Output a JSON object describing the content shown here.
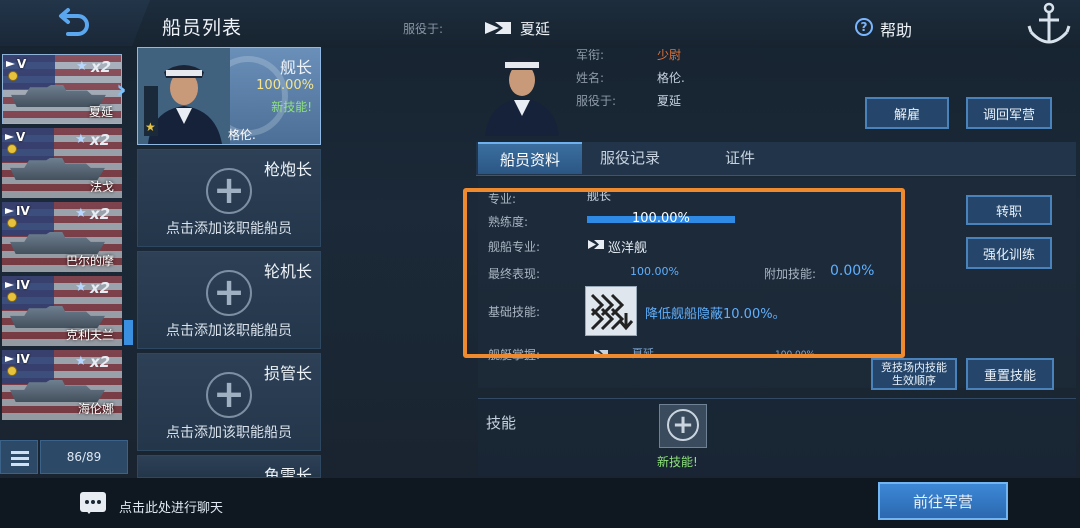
{
  "header": {
    "title": "船员列表",
    "serve_label": "服役于:",
    "serve_ship": "夏延",
    "help": "帮助"
  },
  "ship_list": [
    {
      "tier": "V",
      "count": "x2",
      "name": "夏延",
      "active": true
    },
    {
      "tier": "V",
      "count": "x2",
      "name": "法戈"
    },
    {
      "tier": "IV",
      "count": "x2",
      "name": "巴尔的摩"
    },
    {
      "tier": "IV",
      "count": "x2",
      "name": "克利夫兰"
    },
    {
      "tier": "IV",
      "count": "x2",
      "name": "海伦娜"
    }
  ],
  "crew_count": "86/89",
  "roles": {
    "captain": {
      "name": "舰长",
      "pct": "100.00%",
      "note": "新技能!",
      "crew_name": "格伦."
    },
    "gunnery": {
      "name": "枪炮长",
      "hint": "点击添加该职能船员"
    },
    "engine": {
      "name": "轮机长",
      "hint": "点击添加该职能船员"
    },
    "damage": {
      "name": "损管长",
      "hint": "点击添加该职能船员"
    },
    "torpedo": {
      "name": "鱼雷长"
    }
  },
  "detail": {
    "rank_label": "军衔:",
    "rank_value": "少尉",
    "name_label": "姓名:",
    "name_value": "格伦.",
    "serve_label": "服役于:",
    "serve_value": "夏延",
    "btn_dismiss": "解雇",
    "btn_return": "调回军营",
    "rank_color": "#e2743a"
  },
  "tabs": {
    "info": "船员资料",
    "record": "服役记录",
    "cert": "证件"
  },
  "info": {
    "specialty_label": "专业:",
    "specialty_value": "舰长",
    "proficiency_label": "熟练度:",
    "proficiency_value": "100.00%",
    "proficiency_fraction": 1.0,
    "ship_specialty_label": "舰船专业:",
    "ship_specialty_value": "巡洋舰",
    "final_label": "最终表现:",
    "final_value": "100.00%",
    "extra_label": "附加技能:",
    "extra_value": "0.00%",
    "base_skill_label": "基础技能:",
    "base_skill_desc": "降低舰船隐蔽10.00%。",
    "mastery_label": "舰艇掌握:",
    "mastery_ship": "夏延",
    "mastery_value": "100.00%"
  },
  "buttons": {
    "transfer": "转职",
    "train": "强化训练",
    "arena_line1": "竞技场内技能",
    "arena_line2": "生效顺序",
    "reset": "重置技能",
    "goto": "前往军营"
  },
  "skills": {
    "label": "技能",
    "new_skill": "新技能!"
  },
  "bottom": {
    "chat_hint": "点击此处进行聊天"
  },
  "colors": {
    "accent": "#3b8fe0",
    "highlight": "#f08a2f",
    "new_skill": "#8fe37a"
  }
}
